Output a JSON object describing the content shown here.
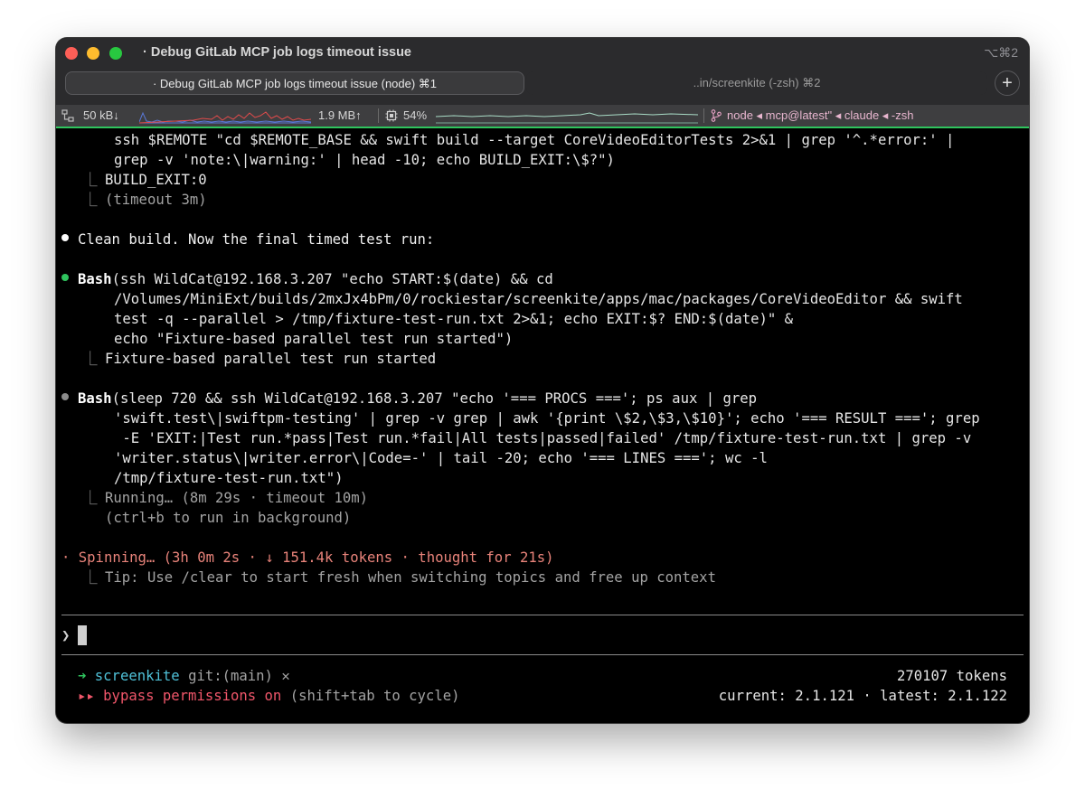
{
  "window": {
    "title": "· Debug GitLab MCP job logs timeout issue",
    "shortcut": "⌥⌘2"
  },
  "tabs": [
    {
      "label": "· Debug GitLab MCP job logs timeout issue (node) ⌘1",
      "active": true
    },
    {
      "label": "..in/screenkite (-zsh) ⌘2",
      "active": false
    }
  ],
  "new_tab_label": "+",
  "statusbar": {
    "net_down": "50 kB↓",
    "net_up": "1.9 MB↑",
    "cpu": "54%",
    "process_chain": "node ◂ mcp@latest\" ◂ claude ◂ -zsh",
    "accent": "#2fc45e"
  },
  "terminal": {
    "block1": {
      "line1": "ssh $REMOTE \"cd $REMOTE_BASE && swift build --target CoreVideoEditorTests 2>&1 | grep '^.*error:' |",
      "line2": "grep -v 'note:\\|warning:' | head -10; echo BUILD_EXIT:\\$?\")",
      "result1": "BUILD_EXIT:0",
      "result2": "(timeout 3m)"
    },
    "message": "Clean build. Now the final timed test run:",
    "bash1": {
      "tool": "Bash",
      "line1": "(ssh WildCat@192.168.3.207 \"echo START:$(date) && cd",
      "line2": "/Volumes/MiniExt/builds/2mxJx4bPm/0/rockiestar/screenkite/apps/mac/packages/CoreVideoEditor && swift",
      "line3": "test -q --parallel > /tmp/fixture-test-run.txt 2>&1; echo EXIT:$? END:$(date)\" &",
      "line4": "echo \"Fixture-based parallel test run started\")",
      "result": "Fixture-based parallel test run started"
    },
    "bash2": {
      "tool": "Bash",
      "line1": "(sleep 720 && ssh WildCat@192.168.3.207 \"echo '=== PROCS ==='; ps aux | grep",
      "line2": "'swift.test\\|swiftpm-testing' | grep -v grep | awk '{print \\$2,\\$3,\\$10}'; echo '=== RESULT ==='; grep",
      "line3": " -E 'EXIT:|Test run.*pass|Test run.*fail|All tests|passed|failed' /tmp/fixture-test-run.txt | grep -v",
      "line4": "'writer.status\\|writer.error\\|Code=-' | tail -20; echo '=== LINES ==='; wc -l",
      "line5": "/tmp/fixture-test-run.txt\")",
      "running": "Running… (8m 29s · timeout 10m)",
      "hint": "(ctrl+b to run in background)"
    },
    "spinner": "· Spinning… (3h 0m 2s · ↓ 151.4k tokens · thought for 21s)",
    "tip": "Tip: Use /clear to start fresh when switching topics and free up context",
    "prompt_char": "❯",
    "footer": {
      "arrow": "➜",
      "dir": "screenkite",
      "git": "git:(main)",
      "dirty": "✕",
      "tokens": "270107 tokens",
      "perm_marker": "▸▸",
      "perm_text": "bypass permissions on",
      "perm_hint": "(shift+tab to cycle)",
      "version": "current: 2.1.121 · latest: 2.1.122"
    }
  }
}
